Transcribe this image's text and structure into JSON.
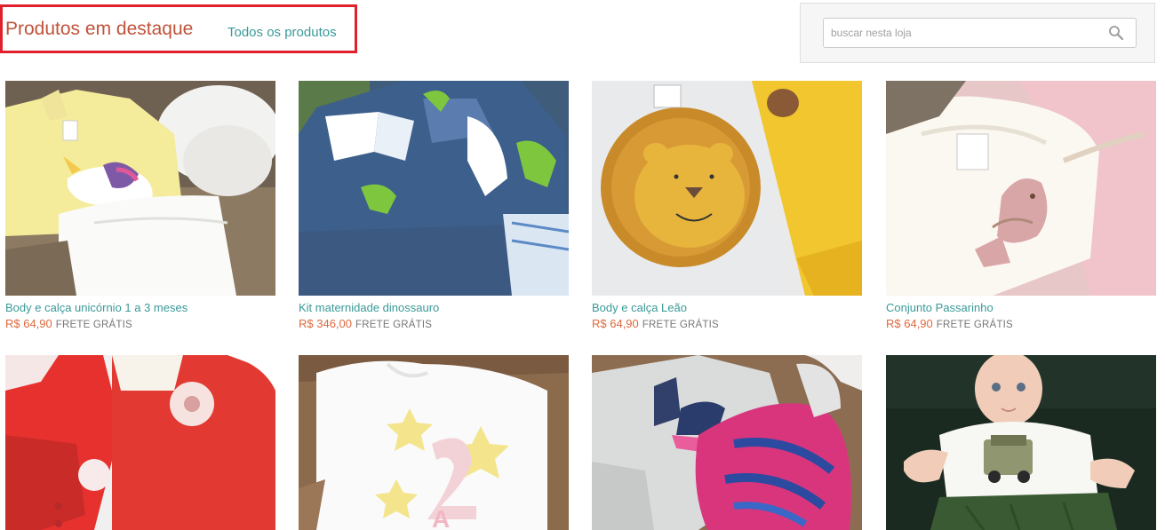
{
  "header": {
    "title": "Produtos em destaque",
    "all_products_link": "Todos os produtos"
  },
  "search": {
    "placeholder": "buscar nesta loja",
    "icon": "search-icon"
  },
  "products": [
    {
      "name": "Body e calça unicórnio 1 a 3 meses",
      "price": "R$ 64,90",
      "shipping": "FRETE GRÁTIS"
    },
    {
      "name": "Kit maternidade dinossauro",
      "price": "R$ 346,00",
      "shipping": "FRETE GRÁTIS"
    },
    {
      "name": "Body e calça Leão",
      "price": "R$ 64,90",
      "shipping": "FRETE GRÁTIS"
    },
    {
      "name": "Conjunto Passarinho",
      "price": "R$ 64,90",
      "shipping": "FRETE GRÁTIS"
    },
    {
      "name": "",
      "price": "",
      "shipping": ""
    },
    {
      "name": "",
      "price": "",
      "shipping": ""
    },
    {
      "name": "",
      "price": "",
      "shipping": ""
    },
    {
      "name": "",
      "price": "",
      "shipping": ""
    }
  ],
  "colors": {
    "title": "#c0533a",
    "link": "#3a9a98",
    "price": "#e0683e",
    "highlight_border": "#e0202a"
  }
}
